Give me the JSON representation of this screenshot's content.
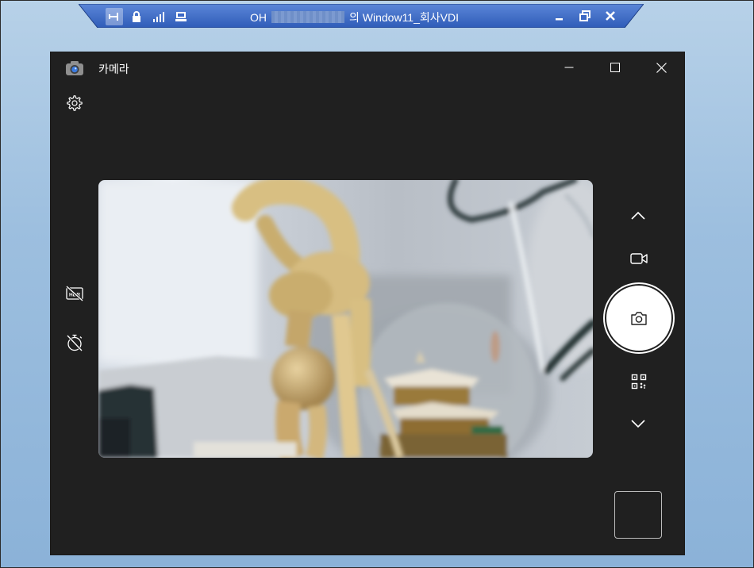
{
  "rdp": {
    "title_prefix": "OH",
    "title_suffix": "의 Window11_회사VDI",
    "icons": [
      "pin-icon",
      "lock-icon",
      "signal-icon",
      "remote-desktop-icon"
    ],
    "controls": [
      "minimize-icon",
      "restore-icon",
      "close-icon"
    ]
  },
  "window": {
    "title": "카메라",
    "controls": [
      "minimize-icon",
      "maximize-icon",
      "close-icon"
    ]
  },
  "left_toolbar": [
    "gear-icon",
    "hdr-off-icon",
    "timer-off-icon"
  ],
  "right_toolbar": [
    "chevron-up-icon",
    "video-mode-icon",
    "photo-capture-icon",
    "qr-code-icon",
    "chevron-down-icon"
  ],
  "colors": {
    "window_bg": "#202020",
    "icon": "#ffffff",
    "rdp_bar": "#3b67c4"
  }
}
